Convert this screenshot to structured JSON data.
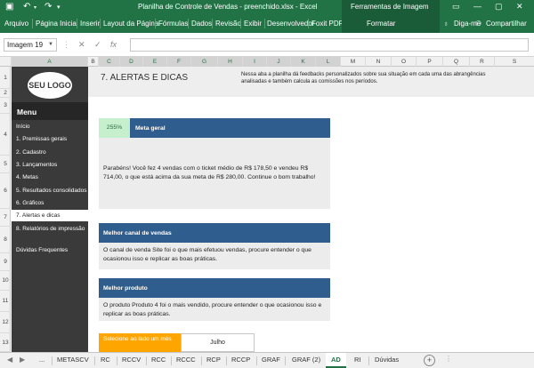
{
  "titlebar": {
    "title": "Planilha de Controle de Vendas - preenchido.xlsx - Excel",
    "context_tab": "Ferramentas de Imagem"
  },
  "ribbon": {
    "tabs": [
      "Arquivo",
      "Página Inicial",
      "Inserir",
      "Layout da Página",
      "Fórmulas",
      "Dados",
      "Revisão",
      "Exibir",
      "Desenvolvedor",
      "Foxit PDF"
    ],
    "contextual_tab": "Formatar",
    "tell_me": "Diga-me",
    "share": "Compartilhar"
  },
  "formula_bar": {
    "name_box": "Imagem 19",
    "fx_label": "fx",
    "value": ""
  },
  "columns": [
    "A",
    "B",
    "C",
    "D",
    "E",
    "F",
    "G",
    "H",
    "I",
    "J",
    "K",
    "L",
    "M",
    "N",
    "O",
    "P",
    "Q",
    "R",
    "S"
  ],
  "rows": [
    "1",
    "2",
    "3",
    "4",
    "5",
    "6",
    "7",
    "8",
    "9",
    "10",
    "11",
    "12",
    "13"
  ],
  "sidebar": {
    "logo": "SEU LOGO",
    "menu_title": "Menu",
    "items": [
      "Início",
      "1. Premissas gerais",
      "2. Cadastro",
      "3. Lançamentos",
      "4. Metas",
      "5. Resultados consolidados",
      "6. Gráficos",
      "7. Alertas e dicas",
      "8. Relatórios de impressão",
      "Dúvidas Frequentes"
    ]
  },
  "header": {
    "title": "7. ALERTAS E DICAS",
    "description": "Nessa aba a planilha dá feedbacks personalizados sobre sua situação em cada uma das abrangências analisadas e também calcula as comissões nos períodos."
  },
  "cards": {
    "meta": {
      "percent": "255%",
      "title": "Meta geral",
      "body": "Parabéns! Você fez 4 vendas com o ticket médio de R$ 178,50 e vendeu R$ 714,00, o que está acima da sua meta de R$ 280,00. Continue o bom trabalho!"
    },
    "canal": {
      "title": "Melhor canal de vendas",
      "body": "O canal de venda Site foi o que mais efetuou vendas, procure entender o que ocasionou isso e replicar as boas práticas."
    },
    "produto": {
      "title": "Melhor produto",
      "body": "O produto Produto 4 foi o mais vendido, procure entender o que ocasionou isso e replicar as boas práticas."
    }
  },
  "selector": {
    "label": "Selecione ao lado um mês",
    "value": "Julho"
  },
  "sheet_tabs": {
    "ellipsis": "...",
    "tabs": [
      "METASCV",
      "RC",
      "RCCV",
      "RCC",
      "RCCC",
      "RCP",
      "RCCP",
      "GRAF",
      "GRAF (2)",
      "AD",
      "RI",
      "Dúvidas"
    ],
    "active": "AD",
    "add": "+"
  }
}
